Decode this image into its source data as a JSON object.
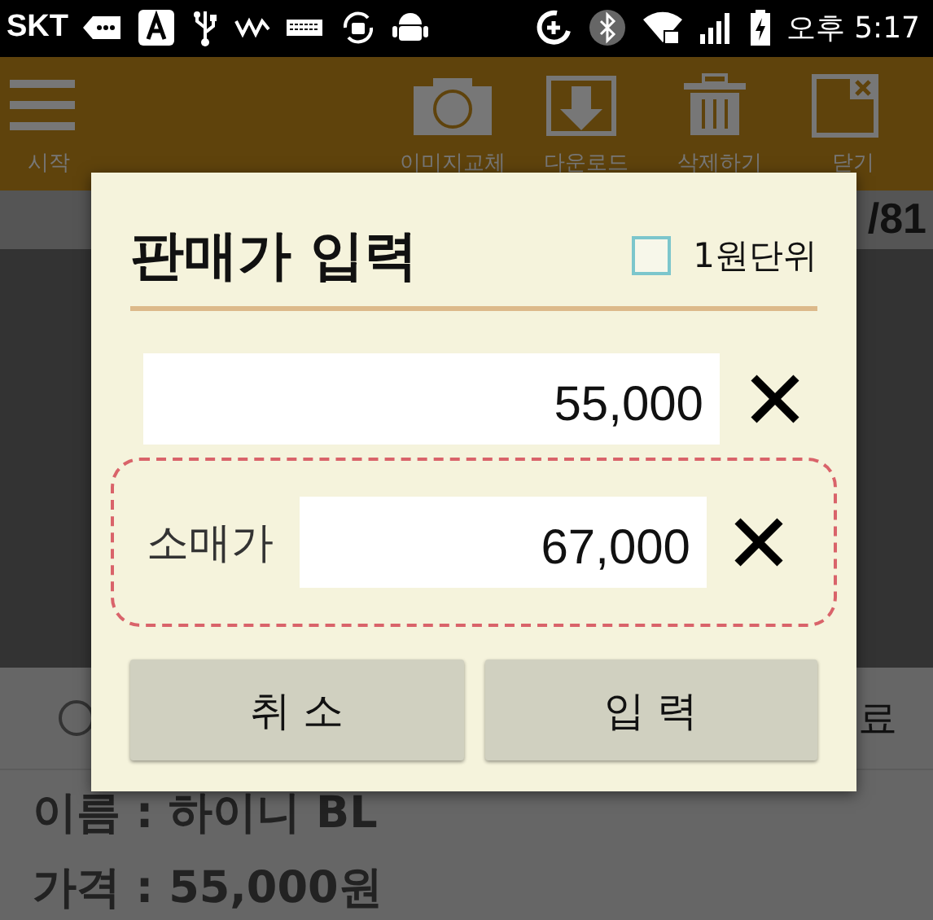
{
  "status_bar": {
    "carrier": "SKT",
    "time": "오후 5:17"
  },
  "toolbar": {
    "items": [
      {
        "kind": "menu",
        "label": "시작"
      },
      {
        "kind": "camera",
        "label": "이미지교체"
      },
      {
        "kind": "download",
        "label": "다운로드"
      },
      {
        "kind": "trash",
        "label": "삭제하기"
      },
      {
        "kind": "close",
        "label": "닫기"
      }
    ]
  },
  "page": {
    "counter": "/81",
    "radio": {
      "selected": false
    },
    "option_label": "료",
    "name_line": "이름 : 하이니 BL",
    "price_line": "가격 : 55,000원"
  },
  "dialog": {
    "title": "판매가 입력",
    "checkbox": {
      "label": "1원단위",
      "checked": false
    },
    "fields": [
      {
        "value": "55,000",
        "highlighted": false
      },
      {
        "label": "소매가",
        "value": "67,000",
        "highlighted": true
      }
    ],
    "buttons": [
      "취 소",
      "입 력"
    ]
  }
}
